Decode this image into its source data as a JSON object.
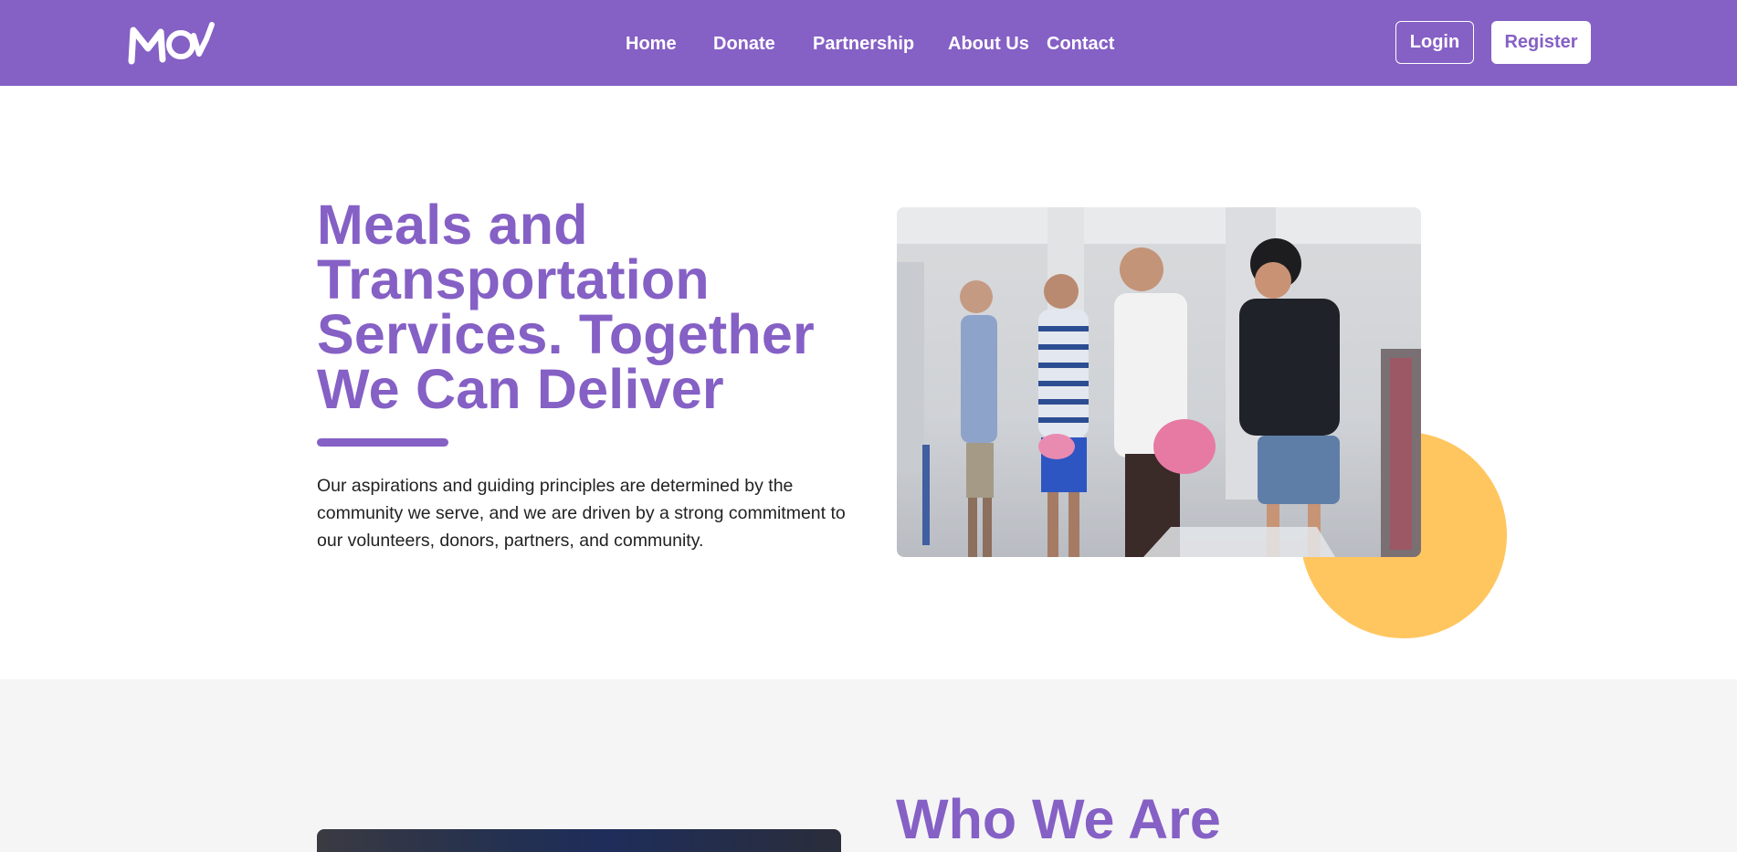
{
  "header": {
    "logo_text": "MOW",
    "nav": {
      "home": "Home",
      "donate": "Donate",
      "partnership": "Partnership",
      "about": "About Us",
      "contact": "Contact"
    },
    "login_label": "Login",
    "register_label": "Register"
  },
  "hero": {
    "title": "Meals and Transportation Services. Together We Can Deliver",
    "description": "Our aspirations and guiding principles are determined by the community we serve, and we are driven by a strong commitment to our volunteers, donors, partners, and community."
  },
  "who": {
    "title": "Who We Are"
  },
  "colors": {
    "brand": "#8560c5",
    "accent": "#ffc65f",
    "section_bg": "#f5f5f5"
  }
}
